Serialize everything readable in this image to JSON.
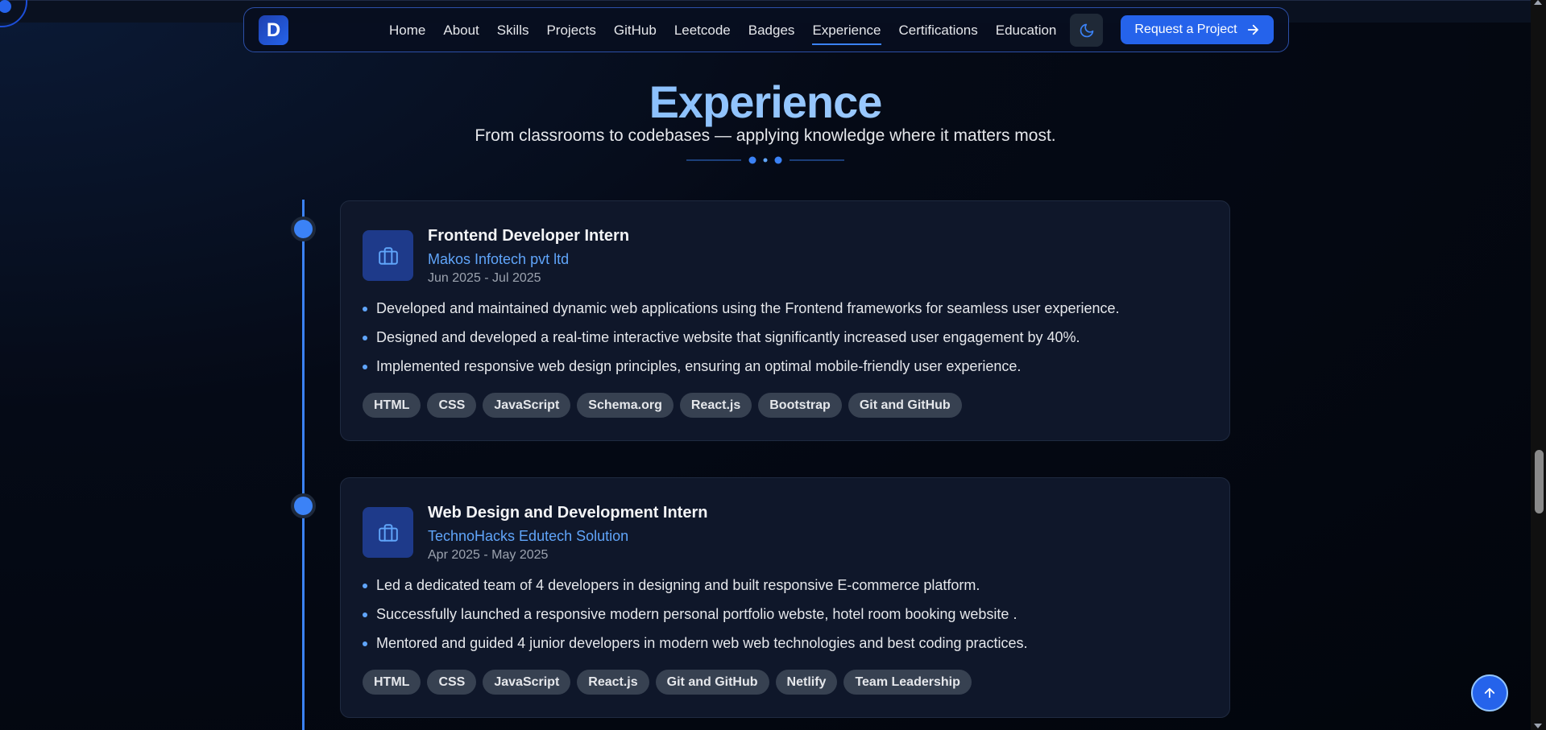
{
  "nav": {
    "logo_letter": "D",
    "links": [
      "Home",
      "About",
      "Skills",
      "Projects",
      "GitHub",
      "Leetcode",
      "Badges",
      "Experience",
      "Certifications",
      "Education"
    ],
    "active": "Experience",
    "cta_label": "Request a Project"
  },
  "header": {
    "title": "Experience",
    "subtitle": "From classrooms to codebases — applying knowledge where it matters most."
  },
  "experiences": [
    {
      "title": "Frontend Developer Intern",
      "company": "Makos Infotech pvt ltd",
      "dates": "Jun 2025 - Jul 2025",
      "bullets": [
        "Developed and maintained dynamic web applications using the Frontend frameworks for seamless user experience.",
        "Designed and developed a real-time interactive website that significantly increased user engagement by 40%.",
        "Implemented responsive web design principles, ensuring an optimal mobile-friendly user experience."
      ],
      "tags": [
        "HTML",
        "CSS",
        "JavaScript",
        "Schema.org",
        "React.js",
        "Bootstrap",
        "Git and GitHub"
      ]
    },
    {
      "title": "Web Design and Development Intern",
      "company": "TechnoHacks Edutech Solution",
      "dates": "Apr 2025 - May 2025",
      "bullets": [
        "Led a dedicated team of 4 developers in designing and built responsive E-commerce platform.",
        "Successfully launched a responsive modern personal portfolio webste, hotel room booking website .",
        "Mentored and guided 4 junior developers in modern web web technologies and best coding practices."
      ],
      "tags": [
        "HTML",
        "CSS",
        "JavaScript",
        "React.js",
        "Git and GitHub",
        "Netlify",
        "Team Leadership"
      ]
    }
  ],
  "icons": {
    "logo": "logo-icon",
    "theme": "moon-icon",
    "cta": "arrow-right-icon",
    "card": "briefcase-icon",
    "scroll_top": "arrow-up-icon"
  },
  "colors": {
    "accent": "#3b82f6",
    "cta": "#2563eb",
    "company": "#60a5fa",
    "card_bg": "#0f172a",
    "tag_bg": "#374151"
  }
}
